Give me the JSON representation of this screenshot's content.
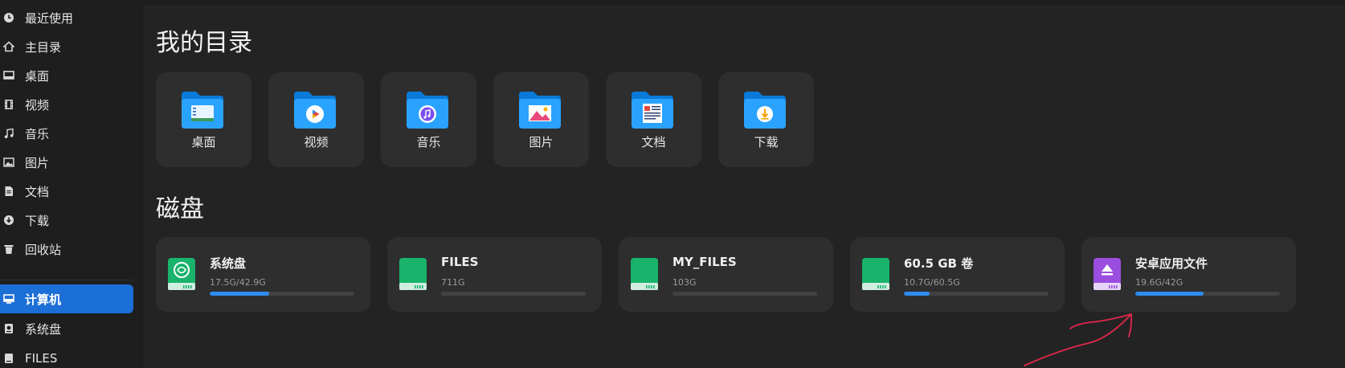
{
  "sidebar": {
    "items": [
      {
        "label": "最近使用",
        "icon": "clock-icon"
      },
      {
        "label": "主目录",
        "icon": "home-icon"
      },
      {
        "label": "桌面",
        "icon": "desktop-icon"
      },
      {
        "label": "视频",
        "icon": "film-icon"
      },
      {
        "label": "音乐",
        "icon": "music-icon"
      },
      {
        "label": "图片",
        "icon": "image-icon"
      },
      {
        "label": "文档",
        "icon": "document-icon"
      },
      {
        "label": "下载",
        "icon": "download-icon"
      },
      {
        "label": "回收站",
        "icon": "trash-icon"
      },
      {
        "label": "计算机",
        "icon": "computer-icon",
        "active": true
      },
      {
        "label": "系统盘",
        "icon": "disk-icon"
      },
      {
        "label": "FILES",
        "icon": "disk-icon"
      }
    ]
  },
  "main": {
    "my_dirs_title": "我的目录",
    "disks_title": "磁盘",
    "folders": [
      {
        "label": "桌面",
        "icon": "desktop-folder-icon"
      },
      {
        "label": "视频",
        "icon": "video-folder-icon"
      },
      {
        "label": "音乐",
        "icon": "music-folder-icon"
      },
      {
        "label": "图片",
        "icon": "pictures-folder-icon"
      },
      {
        "label": "文档",
        "icon": "documents-folder-icon"
      },
      {
        "label": "下载",
        "icon": "downloads-folder-icon"
      }
    ],
    "disks": [
      {
        "name": "系统盘",
        "size": "17.5G/42.9G",
        "usage": 0.41,
        "icon": "system-disk-icon",
        "color": "#19b36b"
      },
      {
        "name": "FILES",
        "size": "711G",
        "usage": 0,
        "icon": "green-disk-icon",
        "color": "#19b36b"
      },
      {
        "name": "MY_FILES",
        "size": "103G",
        "usage": 0,
        "icon": "green-disk-icon",
        "color": "#19b36b"
      },
      {
        "name": "60.5 GB 卷",
        "size": "10.7G/60.5G",
        "usage": 0.18,
        "icon": "green-disk-icon",
        "color": "#19b36b"
      },
      {
        "name": "安卓应用文件",
        "size": "19.6G/42G",
        "usage": 0.47,
        "icon": "eject-disk-icon",
        "color": "#9b4de0"
      }
    ]
  },
  "colors": {
    "accent": "#1c6fd6",
    "bar_fill": "#2f8cf0",
    "annotation": "#e0284a"
  }
}
